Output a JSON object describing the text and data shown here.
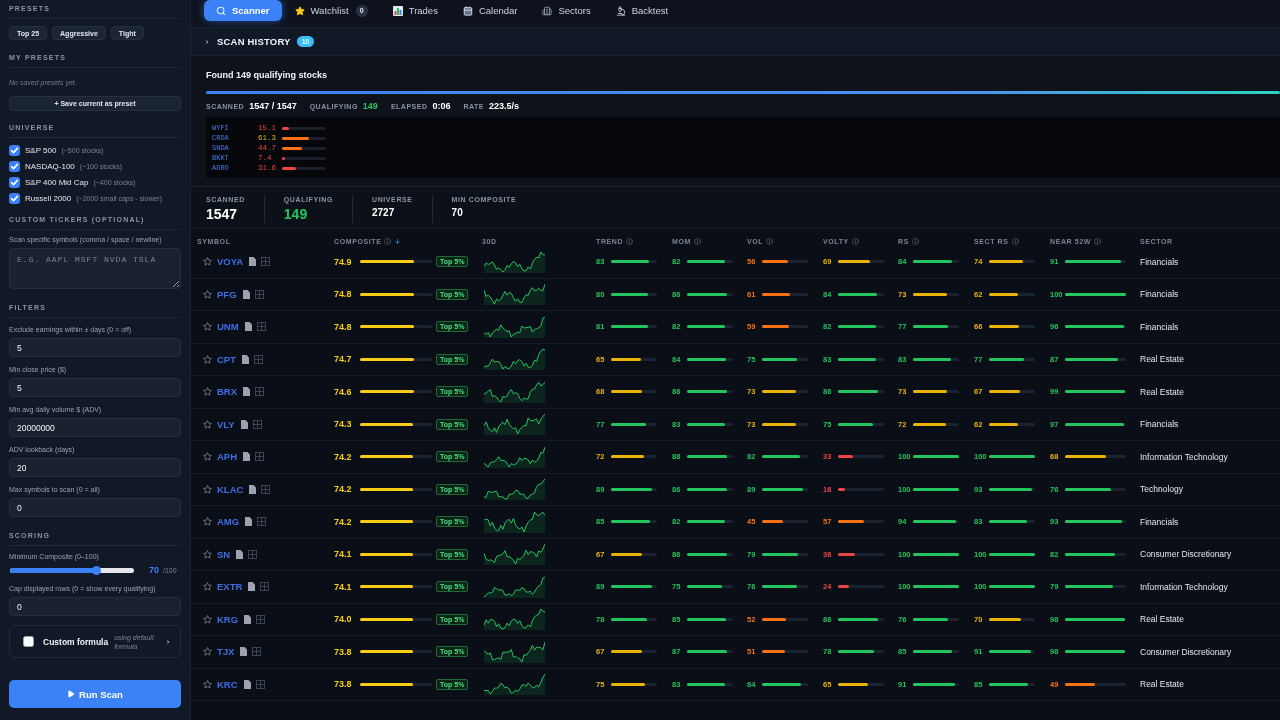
{
  "sidebar": {
    "presets": {
      "heading": "PRESETS",
      "buttons": [
        "Top 25",
        "Aggressive",
        "Tight"
      ]
    },
    "my_presets": {
      "heading": "MY PRESETS",
      "empty_text": "No saved presets yet.",
      "save_button": "+ Save current as preset"
    },
    "universe": {
      "heading": "UNIVERSE",
      "items": [
        {
          "label": "S&P 500",
          "note": "(~500 stocks)",
          "checked": true
        },
        {
          "label": "NASDAQ-100",
          "note": "(~100 stocks)",
          "checked": true
        },
        {
          "label": "S&P 400 Mid Cap",
          "note": "(~400 stocks)",
          "checked": true
        },
        {
          "label": "Russell 2000",
          "note": "(~2000 small caps - slower)",
          "checked": true
        }
      ]
    },
    "custom_tickers": {
      "heading": "CUSTOM TICKERS (OPTIONAL)",
      "label": "Scan specific symbols (comma / space / newline)",
      "placeholder": "E.G. AAPL MSFT NVDA TSLA"
    },
    "filters": {
      "heading": "FILTERS",
      "fields": [
        {
          "label": "Exclude earnings within ± days (0 = off)",
          "value": "5"
        },
        {
          "label": "Min close price ($)",
          "value": "5"
        },
        {
          "label": "Min avg daily volume $ (ADV)",
          "value": "20000000"
        },
        {
          "label": "ADV lookback (days)",
          "value": "20"
        },
        {
          "label": "Max symbols to scan (0 = all)",
          "value": "0"
        }
      ]
    },
    "scoring": {
      "heading": "SCORING",
      "slider": {
        "label": "Minimum Composite (0–100)",
        "level": 0.7,
        "value": "70",
        "max": "/100"
      },
      "fields": [
        {
          "label": "Cap displayed rows (0 = show every qualifying)",
          "value": "0"
        }
      ]
    },
    "custom_formula": {
      "label": "Custom formula",
      "checked": false,
      "note": "using default formula"
    },
    "run_button": "Run Scan"
  },
  "tabs": [
    {
      "label": "Scanner",
      "selected": true
    },
    {
      "label": "Watchlist",
      "selected": false,
      "badge": "0"
    },
    {
      "label": "Trades",
      "selected": false
    },
    {
      "label": "Calendar",
      "selected": false
    },
    {
      "label": "Sectors",
      "selected": false
    },
    {
      "label": "Backtest",
      "selected": false
    }
  ],
  "scan_history": {
    "title": "SCAN HISTORY",
    "count": "10"
  },
  "progress": {
    "title": "Found 149 qualifying stocks",
    "level": 1,
    "stats": [
      {
        "label": "SCANNED",
        "value": "1547 / 1547",
        "color": "#ffffff"
      },
      {
        "label": "QUALIFYING",
        "value": "149",
        "color": "#22c55e"
      },
      {
        "label": "ELAPSED",
        "value": "0:06",
        "color": "#ffffff"
      },
      {
        "label": "RATE",
        "value": "223.5/s",
        "color": "#ffffff"
      }
    ]
  },
  "live_feed": {
    "rows": [
      {
        "symbol": "WYFI",
        "score": "15.1",
        "level": 0.151
      },
      {
        "symbol": "CRDA",
        "score": "61.3",
        "level": 0.613
      },
      {
        "symbol": "SNDA",
        "score": "44.7",
        "level": 0.447
      },
      {
        "symbol": "BKKT",
        "score": "7.4",
        "level": 0.074
      },
      {
        "symbol": "ADRO",
        "score": "31.6",
        "level": 0.316
      }
    ]
  },
  "summary": [
    {
      "label": "SCANNED",
      "value": "1547",
      "kind": "primary",
      "color": "#ffffff"
    },
    {
      "label": "QUALIFYING",
      "value": "149",
      "kind": "primary",
      "color": "#22c55e"
    },
    {
      "label": "UNIVERSE",
      "value": "2727",
      "kind": "secondary",
      "color": "#ffffff"
    },
    {
      "label": "MIN COMPOSITE",
      "value": "70",
      "kind": "secondary",
      "color": "#ffffff"
    }
  ],
  "table": {
    "columns": [
      {
        "label": "SYMBOL",
        "info": false,
        "sorted": false
      },
      {
        "label": "COMPOSITE",
        "info": true,
        "sorted": true
      },
      {
        "label": "30D",
        "info": false,
        "sorted": false
      },
      {
        "label": "TREND",
        "info": true,
        "sorted": false
      },
      {
        "label": "MOM",
        "info": true,
        "sorted": false
      },
      {
        "label": "VOL",
        "info": true,
        "sorted": false
      },
      {
        "label": "VOLTY",
        "info": true,
        "sorted": false
      },
      {
        "label": "RS",
        "info": true,
        "sorted": false
      },
      {
        "label": "SECT RS",
        "info": true,
        "sorted": false
      },
      {
        "label": "NEAR 52W",
        "info": true,
        "sorted": false
      },
      {
        "label": "SECTOR",
        "info": false,
        "sorted": false
      }
    ],
    "rows": [
      {
        "symbol": "VOYA",
        "starred": false,
        "composite": {
          "value": "74.9",
          "level": 0.749
        },
        "badge": "Top 5%",
        "metrics": [
          {
            "value": "83",
            "level": 0.83
          },
          {
            "value": "82",
            "level": 0.82
          },
          {
            "value": "56",
            "level": 0.56
          },
          {
            "value": "69",
            "level": 0.69
          },
          {
            "value": "84",
            "level": 0.84
          },
          {
            "value": "74",
            "level": 0.74
          },
          {
            "value": "91",
            "level": 0.91
          }
        ],
        "sector": "Financials"
      },
      {
        "symbol": "PFG",
        "starred": false,
        "composite": {
          "value": "74.8",
          "level": 0.748
        },
        "badge": "Top 5%",
        "metrics": [
          {
            "value": "80",
            "level": 0.8
          },
          {
            "value": "86",
            "level": 0.86
          },
          {
            "value": "61",
            "level": 0.61
          },
          {
            "value": "84",
            "level": 0.84
          },
          {
            "value": "73",
            "level": 0.73
          },
          {
            "value": "62",
            "level": 0.62
          },
          {
            "value": "100",
            "level": 1
          }
        ],
        "sector": "Financials"
      },
      {
        "symbol": "UNM",
        "starred": false,
        "composite": {
          "value": "74.8",
          "level": 0.748
        },
        "badge": "Top 5%",
        "metrics": [
          {
            "value": "81",
            "level": 0.81
          },
          {
            "value": "82",
            "level": 0.82
          },
          {
            "value": "59",
            "level": 0.59
          },
          {
            "value": "82",
            "level": 0.82
          },
          {
            "value": "77",
            "level": 0.77
          },
          {
            "value": "66",
            "level": 0.66
          },
          {
            "value": "96",
            "level": 0.96
          }
        ],
        "sector": "Financials"
      },
      {
        "symbol": "CPT",
        "starred": false,
        "composite": {
          "value": "74.7",
          "level": 0.747
        },
        "badge": "Top 5%",
        "metrics": [
          {
            "value": "65",
            "level": 0.65
          },
          {
            "value": "84",
            "level": 0.84
          },
          {
            "value": "75",
            "level": 0.75
          },
          {
            "value": "83",
            "level": 0.83
          },
          {
            "value": "83",
            "level": 0.83
          },
          {
            "value": "77",
            "level": 0.77
          },
          {
            "value": "87",
            "level": 0.87
          }
        ],
        "sector": "Real Estate"
      },
      {
        "symbol": "BRX",
        "starred": false,
        "composite": {
          "value": "74.6",
          "level": 0.746
        },
        "badge": "Top 5%",
        "metrics": [
          {
            "value": "68",
            "level": 0.68
          },
          {
            "value": "86",
            "level": 0.86
          },
          {
            "value": "73",
            "level": 0.73
          },
          {
            "value": "86",
            "level": 0.86
          },
          {
            "value": "73",
            "level": 0.73
          },
          {
            "value": "67",
            "level": 0.67
          },
          {
            "value": "99",
            "level": 0.99
          }
        ],
        "sector": "Real Estate"
      },
      {
        "symbol": "VLY",
        "starred": false,
        "composite": {
          "value": "74.3",
          "level": 0.743
        },
        "badge": "Top 5%",
        "metrics": [
          {
            "value": "77",
            "level": 0.77
          },
          {
            "value": "83",
            "level": 0.83
          },
          {
            "value": "73",
            "level": 0.73
          },
          {
            "value": "75",
            "level": 0.75
          },
          {
            "value": "72",
            "level": 0.72
          },
          {
            "value": "62",
            "level": 0.62
          },
          {
            "value": "97",
            "level": 0.97
          }
        ],
        "sector": "Financials"
      },
      {
        "symbol": "APH",
        "starred": false,
        "composite": {
          "value": "74.2",
          "level": 0.742
        },
        "badge": "Top 5%",
        "metrics": [
          {
            "value": "72",
            "level": 0.72
          },
          {
            "value": "88",
            "level": 0.88
          },
          {
            "value": "82",
            "level": 0.82
          },
          {
            "value": "33",
            "level": 0.33
          },
          {
            "value": "100",
            "level": 1
          },
          {
            "value": "100",
            "level": 1
          },
          {
            "value": "68",
            "level": 0.68
          }
        ],
        "sector": "Information Technology"
      },
      {
        "symbol": "KLAC",
        "starred": false,
        "composite": {
          "value": "74.2",
          "level": 0.742
        },
        "badge": "Top 5%",
        "metrics": [
          {
            "value": "89",
            "level": 0.89
          },
          {
            "value": "86",
            "level": 0.86
          },
          {
            "value": "89",
            "level": 0.89
          },
          {
            "value": "16",
            "level": 0.16
          },
          {
            "value": "100",
            "level": 1
          },
          {
            "value": "93",
            "level": 0.93
          },
          {
            "value": "76",
            "level": 0.76
          }
        ],
        "sector": "Technology"
      },
      {
        "symbol": "AMG",
        "starred": false,
        "composite": {
          "value": "74.2",
          "level": 0.742
        },
        "badge": "Top 5%",
        "metrics": [
          {
            "value": "85",
            "level": 0.85
          },
          {
            "value": "82",
            "level": 0.82
          },
          {
            "value": "45",
            "level": 0.45
          },
          {
            "value": "57",
            "level": 0.57
          },
          {
            "value": "94",
            "level": 0.94
          },
          {
            "value": "83",
            "level": 0.83
          },
          {
            "value": "93",
            "level": 0.93
          }
        ],
        "sector": "Financials"
      },
      {
        "symbol": "SN",
        "starred": false,
        "composite": {
          "value": "74.1",
          "level": 0.741
        },
        "badge": "Top 5%",
        "metrics": [
          {
            "value": "67",
            "level": 0.67
          },
          {
            "value": "86",
            "level": 0.86
          },
          {
            "value": "79",
            "level": 0.79
          },
          {
            "value": "36",
            "level": 0.36
          },
          {
            "value": "100",
            "level": 1
          },
          {
            "value": "100",
            "level": 1
          },
          {
            "value": "82",
            "level": 0.82
          }
        ],
        "sector": "Consumer Discretionary"
      },
      {
        "symbol": "EXTR",
        "starred": false,
        "composite": {
          "value": "74.1",
          "level": 0.741
        },
        "badge": "Top 5%",
        "metrics": [
          {
            "value": "89",
            "level": 0.89
          },
          {
            "value": "75",
            "level": 0.75
          },
          {
            "value": "76",
            "level": 0.76
          },
          {
            "value": "24",
            "level": 0.24
          },
          {
            "value": "100",
            "level": 1
          },
          {
            "value": "100",
            "level": 1
          },
          {
            "value": "79",
            "level": 0.79
          }
        ],
        "sector": "Information Technology"
      },
      {
        "symbol": "KRG",
        "starred": false,
        "composite": {
          "value": "74.0",
          "level": 0.74
        },
        "badge": "Top 5%",
        "metrics": [
          {
            "value": "78",
            "level": 0.78
          },
          {
            "value": "85",
            "level": 0.85
          },
          {
            "value": "52",
            "level": 0.52
          },
          {
            "value": "86",
            "level": 0.86
          },
          {
            "value": "76",
            "level": 0.76
          },
          {
            "value": "70",
            "level": 0.7
          },
          {
            "value": "98",
            "level": 0.98
          }
        ],
        "sector": "Real Estate"
      },
      {
        "symbol": "TJX",
        "starred": false,
        "composite": {
          "value": "73.8",
          "level": 0.738
        },
        "badge": "Top 5%",
        "metrics": [
          {
            "value": "67",
            "level": 0.67
          },
          {
            "value": "87",
            "level": 0.87
          },
          {
            "value": "51",
            "level": 0.51
          },
          {
            "value": "78",
            "level": 0.78
          },
          {
            "value": "85",
            "level": 0.85
          },
          {
            "value": "91",
            "level": 0.91
          },
          {
            "value": "98",
            "level": 0.98
          }
        ],
        "sector": "Consumer Discretionary"
      },
      {
        "symbol": "KRC",
        "starred": false,
        "composite": {
          "value": "73.8",
          "level": 0.738
        },
        "badge": "Top 5%",
        "metrics": [
          {
            "value": "75",
            "level": 0.745
          },
          {
            "value": "83",
            "level": 0.83
          },
          {
            "value": "84",
            "level": 0.84
          },
          {
            "value": "65",
            "level": 0.65
          },
          {
            "value": "91",
            "level": 0.91
          },
          {
            "value": "85",
            "level": 0.85
          },
          {
            "value": "49",
            "level": 0.49
          }
        ],
        "sector": "Real Estate"
      }
    ]
  }
}
